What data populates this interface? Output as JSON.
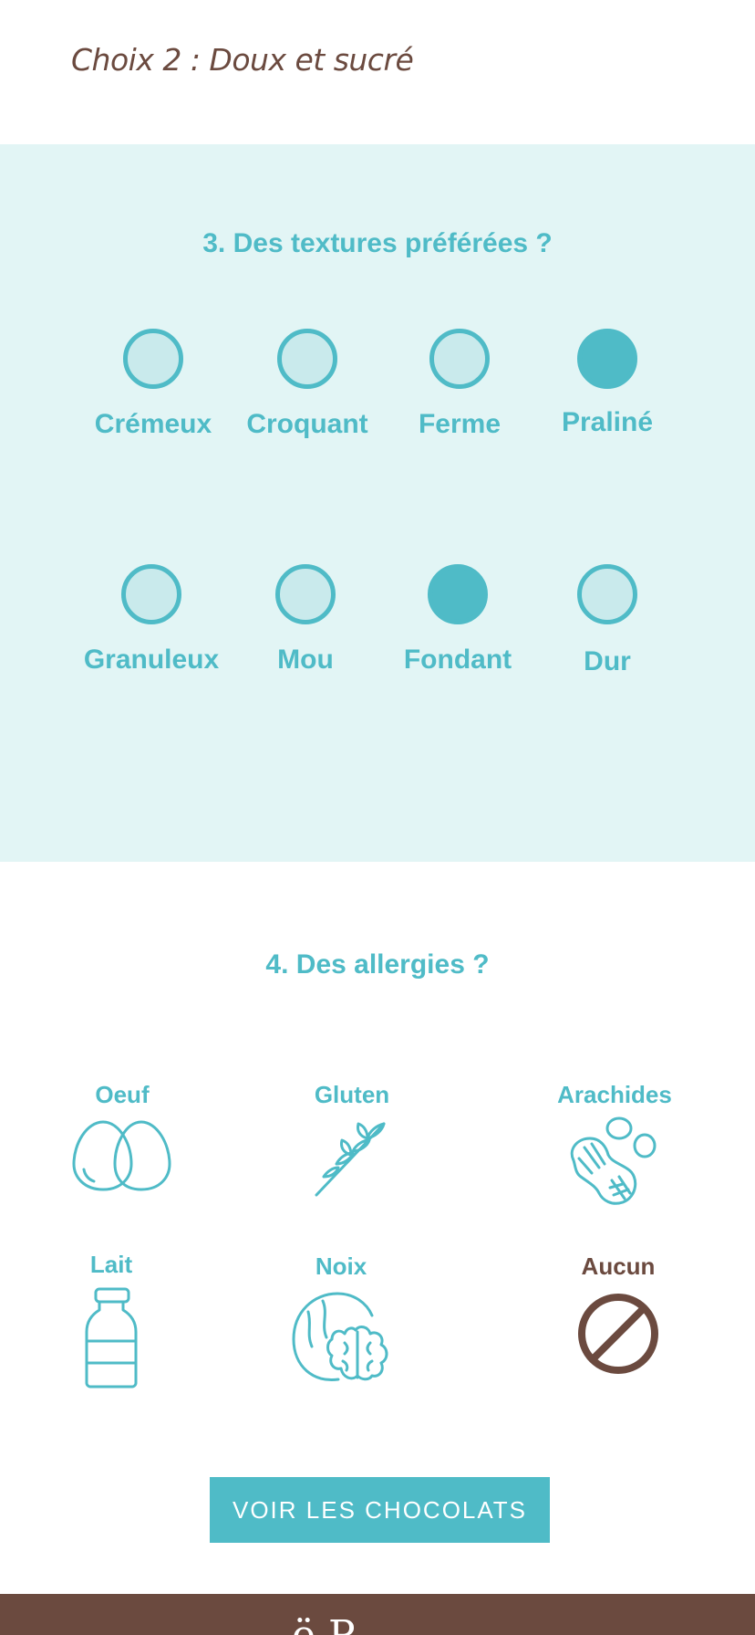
{
  "header": {
    "choice_label": "Choix 2 : Doux et sucré"
  },
  "textures": {
    "title": "3. Des textures préférées ?",
    "items": [
      {
        "label": "Crémeux",
        "selected": false
      },
      {
        "label": "Croquant",
        "selected": false
      },
      {
        "label": "Ferme",
        "selected": false
      },
      {
        "label": "Praliné",
        "selected": true
      },
      {
        "label": "Granuleux",
        "selected": false
      },
      {
        "label": "Mou",
        "selected": false
      },
      {
        "label": "Fondant",
        "selected": true
      },
      {
        "label": "Dur",
        "selected": false
      }
    ]
  },
  "allergies": {
    "title": "4. Des allergies ?",
    "items": [
      {
        "label": "Oeuf",
        "icon": "eggs-icon"
      },
      {
        "label": "Gluten",
        "icon": "wheat-icon"
      },
      {
        "label": "Arachides",
        "icon": "peanut-icon"
      },
      {
        "label": "Lait",
        "icon": "milk-bottle-icon"
      },
      {
        "label": "Noix",
        "icon": "walnut-icon"
      },
      {
        "label": "Aucun",
        "icon": "none-icon"
      }
    ]
  },
  "cta": {
    "label": "VOIR LES CHOCOLATS"
  },
  "colors": {
    "accent": "#4fbbc7",
    "light_bg": "#e2f5f5",
    "circle_fill": "#c9eaec",
    "brown": "#6b4a3f"
  },
  "footer": {
    "logo_partial": "ë P"
  }
}
